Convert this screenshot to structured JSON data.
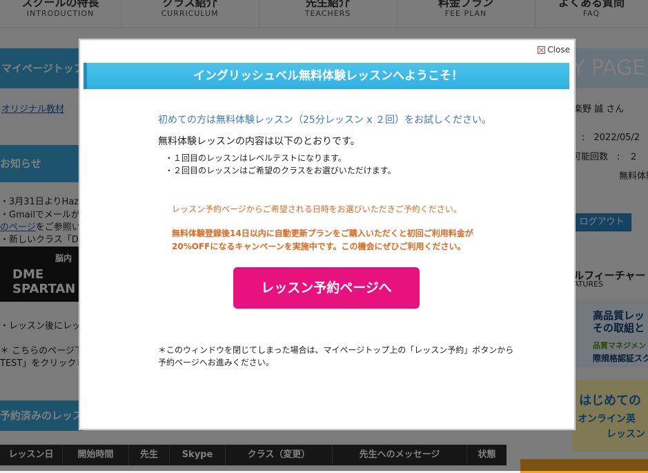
{
  "nav": [
    {
      "jp": "スクールの特長",
      "en": "INTRODUCTION"
    },
    {
      "jp": "クラス紹介",
      "en": "CURRICULUM"
    },
    {
      "jp": "先生紹介",
      "en": "TEACHERS"
    },
    {
      "jp": "料金プラン",
      "en": "FEE PLAN"
    },
    {
      "jp": "よくある質問",
      "en": "FAQ"
    }
  ],
  "background": {
    "mypage_top_tab": "マイページトップ",
    "page_heading": "Y PAGE",
    "original_materials_link": "オリジナル教材",
    "user_name": "楽野 誠 さん",
    "date_row": ":　2022/05/2",
    "remaining_row": "可能回数　:　２",
    "trial_label": "無料体験",
    "news_heading": "お知らせ",
    "news1": "・3月31日よりHazel先",
    "news2": "・Gmailでメールが受",
    "news3_link": "のページ",
    "news3_rest": "をご参照いた",
    "news4": "・新しいクラス「DME",
    "banner_dme_top": "脳内",
    "banner_dme": "DME SPARTAN",
    "news5": "・レッスン後にレッス",
    "news6": "＊ こちらのページ下部",
    "news7": "TEST」をクリックして",
    "logout": "ログアウト",
    "features_jp": "ルフィーチャー",
    "features_en": "ATURES",
    "feature_banner1": "高品質レッ",
    "feature_banner1b": "その取組と",
    "feature_banner1c": "品質マネジメン",
    "feature_banner1d": "際規格認証スク",
    "feature_banner2": "はじめての",
    "feature_banner2b": "オンライン英",
    "feature_banner2c": "レッスン",
    "reserved_heading": "予約済みのレッス",
    "table_headers": [
      "レッスン日",
      "開始時間",
      "先生",
      "Skype",
      "クラス（変更）",
      "先生へのメッセージ",
      "状態"
    ]
  },
  "modal": {
    "close_label": "Close",
    "title": "イングリッシュベル無料体験レッスンへようこそ！",
    "intro": "初めての方は無料体験レッスン（25分レッスン x ２回）をお試しください。",
    "content_heading": "無料体験レッスンの内容は以下のとおりです。",
    "bullet1": "・１回目のレッスンはレベルテストになります。",
    "bullet2": "・２回目のレッスンはご希望のクラスをお選びいただけます。",
    "booking_note": "レッスン予約ページからご希望される日時をお選びいただきご予約ください。",
    "campaign_line1": "無料体験登録後14日以内に自動更新プランをご購入いただくと初回ご利用料金が",
    "campaign_line2": "20%OFFになるキャンペーンを実施中です。この機会にぜひご利用ください。",
    "cta_label": "レッスン予約ページへ",
    "footnote_line1": "＊このウィンドウを閉じてしまった場合は、マイページトップ上の「レッスン予約」ボタンから",
    "footnote_line2": "予約ページへお進みください。"
  },
  "colors": {
    "title_bar": "#3bb8e6",
    "cta": "#e8127e",
    "accent_orange": "#e0691f",
    "intro_blue": "#3a7bbf"
  }
}
